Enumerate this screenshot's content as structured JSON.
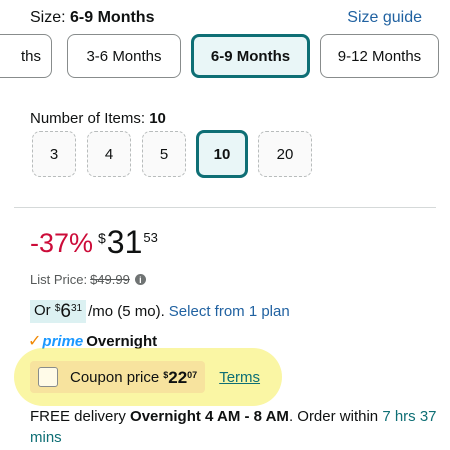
{
  "size": {
    "label": "Size:",
    "selected": "6-9 Months",
    "guide_link": "Size guide",
    "options": [
      "ths",
      "3-6 Months",
      "6-9 Months",
      "9-12 Months"
    ]
  },
  "quantity": {
    "label": "Number of Items:",
    "selected": "10",
    "options": [
      "3",
      "4",
      "5",
      "10",
      "20"
    ]
  },
  "price": {
    "discount": "-37%",
    "currency": "$",
    "whole": "31",
    "fraction": "53",
    "list_label": "List Price:",
    "list_value": "$49.99",
    "info_icon": "i"
  },
  "monthly": {
    "prefix": "Or",
    "currency": "$",
    "whole": "6",
    "fraction": "31",
    "suffix": "/mo (5 mo).",
    "plan_link": "Select from 1 plan"
  },
  "prime": {
    "check": "✓",
    "word": "prime",
    "speed": "Overnight"
  },
  "coupon": {
    "label": "Coupon price",
    "currency": "$",
    "whole": "22",
    "fraction": "07",
    "terms": "Terms"
  },
  "delivery": {
    "free": "FREE delivery",
    "when": "Overnight 4 AM - 8 AM",
    "order_within": ". Order within",
    "countdown": "7 hrs 37 mins"
  },
  "colors": {
    "accent_teal": "#0e6f75",
    "link_blue": "#2162a1",
    "discount_red": "#cc0c39",
    "highlight_yellow": "#f5ee5a"
  }
}
